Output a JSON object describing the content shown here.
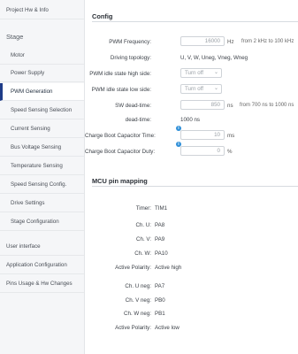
{
  "sidebar": {
    "top_item": "Project Hw & Info",
    "stage_header": "Stage",
    "items": [
      "Motor",
      "Power Supply",
      "PWM Generation",
      "Speed Sensing Selection",
      "Current Sensing",
      "Bus Voltage Sensing",
      "Temperature Sensing",
      "Speed Sensing Config.",
      "Drive Settings",
      "Stage Configuration"
    ],
    "bottom_items": [
      "User interface",
      "Application Configuration",
      "Pins Usage & Hw Changes"
    ],
    "active_item": "PWM Generation"
  },
  "config": {
    "title": "Config",
    "pwm_frequency": {
      "label": "PWM Frequency:",
      "value": "16000",
      "unit": "Hz",
      "range": "from 2 kHz to 100 kHz"
    },
    "driving_topology": {
      "label": "Driving topology:",
      "value": "U, V, W, Uneg, Vneg, Wneg"
    },
    "pwm_idle_high": {
      "label": "PWM idle state high side:",
      "value": "Turn off"
    },
    "pwm_idle_low": {
      "label": "PWM idle state low side:",
      "value": "Turn off"
    },
    "sw_dead_time": {
      "label": "SW dead-time:",
      "value": "850",
      "unit": "ns",
      "range": "from 700 ns to 1000 ns"
    },
    "dead_time": {
      "label": "dead-time:",
      "value": "1000 ns"
    },
    "charge_boot_time": {
      "label": "Charge Boot Capacitor Time:",
      "value": "10",
      "unit": "ms"
    },
    "charge_boot_duty": {
      "label": "Charge Boot Capacitor Duty:",
      "value": "0",
      "unit": "%"
    }
  },
  "mcu": {
    "title": "MCU pin mapping",
    "rows": [
      {
        "label": "Timer:",
        "value": "TIM1"
      },
      {
        "label": "Ch. U:",
        "value": "PA8"
      },
      {
        "label": "Ch. V:",
        "value": "PA9"
      },
      {
        "label": "Ch. W:",
        "value": "PA10"
      },
      {
        "label": "Active Polarity:",
        "value": "Active high"
      },
      {
        "label": "Ch. U neg:",
        "value": "PA7"
      },
      {
        "label": "Ch. V neg:",
        "value": "PB0"
      },
      {
        "label": "Ch. W neg:",
        "value": "PB1"
      },
      {
        "label": "Active Polarity:",
        "value": "Active low"
      }
    ]
  },
  "icons": {
    "info": "info-icon",
    "dropdown": "chevron-down-icon"
  },
  "colors": {
    "accent": "#1f3c88",
    "info": "#2f8fd8",
    "sidebar_bg": "#f5f6f8"
  }
}
